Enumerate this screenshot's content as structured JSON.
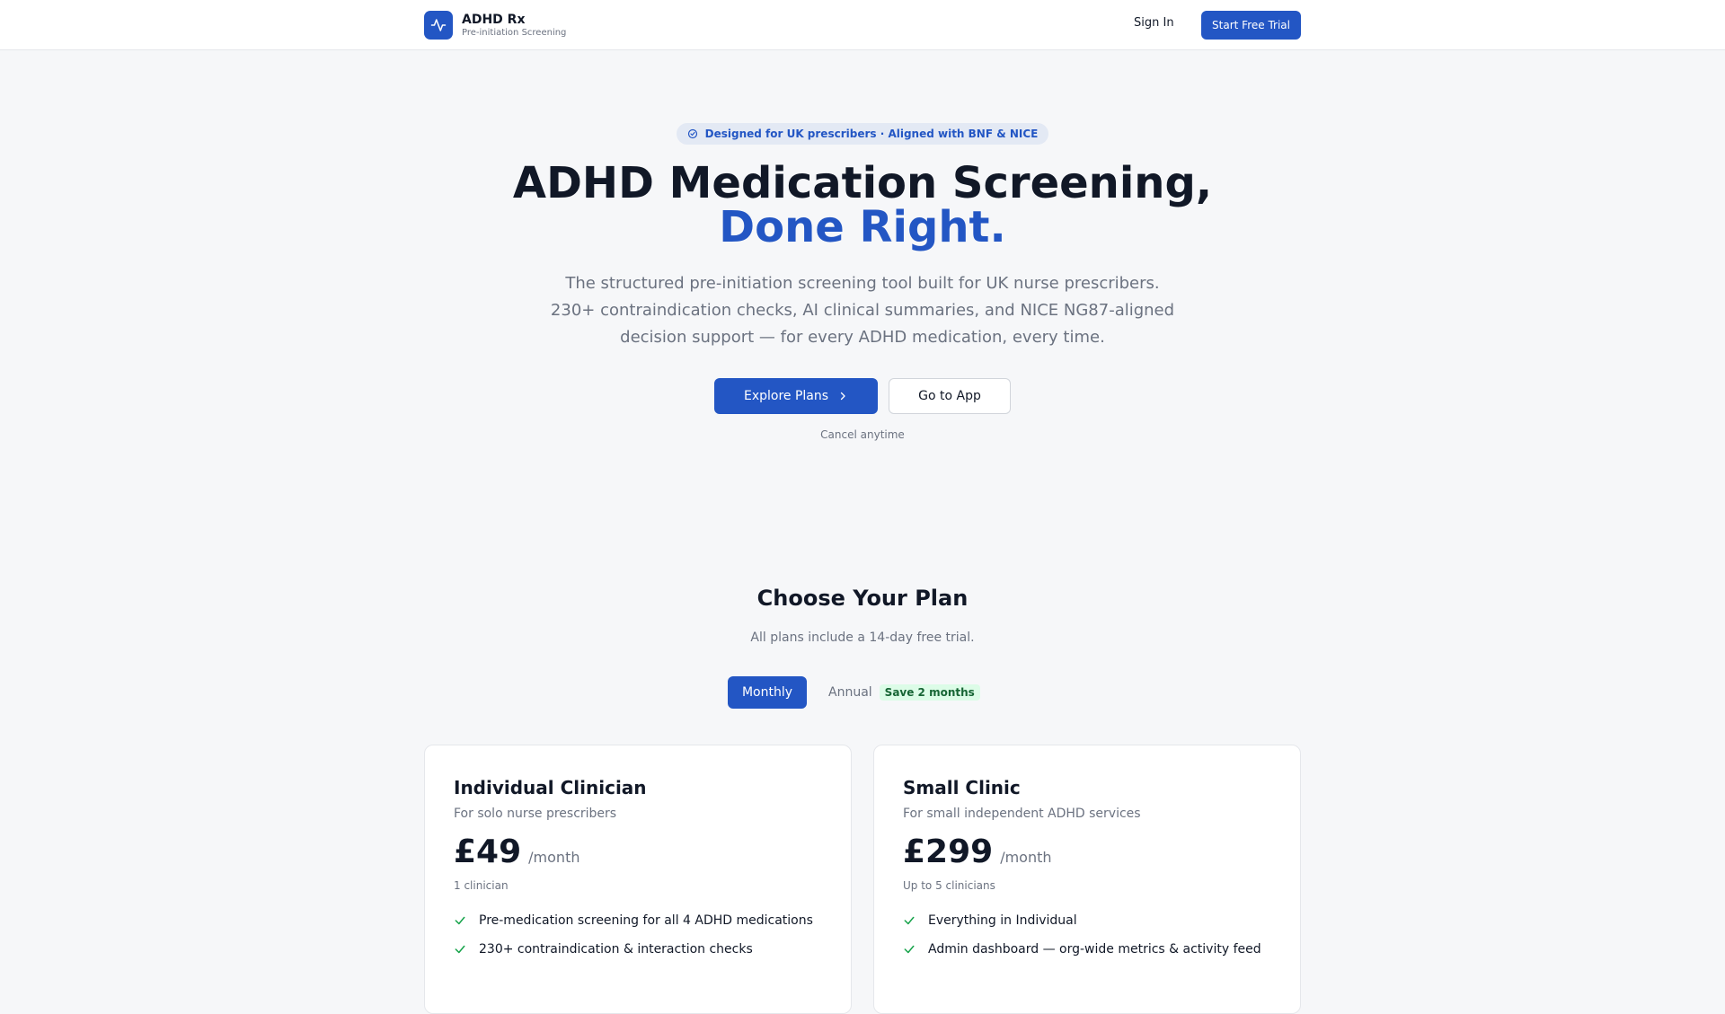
{
  "header": {
    "brand_name": "ADHD Rx",
    "brand_sub": "Pre-initiation Screening",
    "logo_icon": "activity-pulse-icon",
    "signin_label": "Sign In",
    "trial_label": "Start Free Trial"
  },
  "hero": {
    "badge": "Designed for UK prescribers · Aligned with BNF & NICE",
    "title_line1": "ADHD Medication Screening,",
    "title_line2": "Done Right.",
    "subtitle": "The structured pre-initiation screening tool built for UK nurse prescribers. 230+ contraindication checks, AI clinical summaries, and NICE NG87-aligned decision support — for every ADHD medication, every time.",
    "explore_label": "Explore Plans",
    "goapp_label": "Go to App",
    "cancel_note": "Cancel anytime"
  },
  "plans": {
    "title": "Choose Your Plan",
    "subtitle": "All plans include a 14-day free trial.",
    "toggle": {
      "monthly": "Monthly",
      "annual": "Annual",
      "save": "Save 2 months",
      "selected": "Monthly"
    },
    "cards": [
      {
        "name": "Individual Clinician",
        "desc": "For solo nurse prescribers",
        "price": "£49",
        "period": "/month",
        "seats": "1 clinician",
        "features": [
          "Pre-medication screening for all 4 ADHD medications",
          "230+ contraindication & interaction checks"
        ]
      },
      {
        "name": "Small Clinic",
        "desc": "For small independent ADHD services",
        "price": "£299",
        "period": "/month",
        "seats": "Up to 5 clinicians",
        "features": [
          "Everything in Individual",
          "Admin dashboard — org-wide metrics & activity feed"
        ]
      }
    ]
  },
  "colors": {
    "primary": "#2356c4",
    "background": "#f6f7f9",
    "text": "#111827",
    "muted": "#6b7280",
    "success": "#16a34a"
  }
}
